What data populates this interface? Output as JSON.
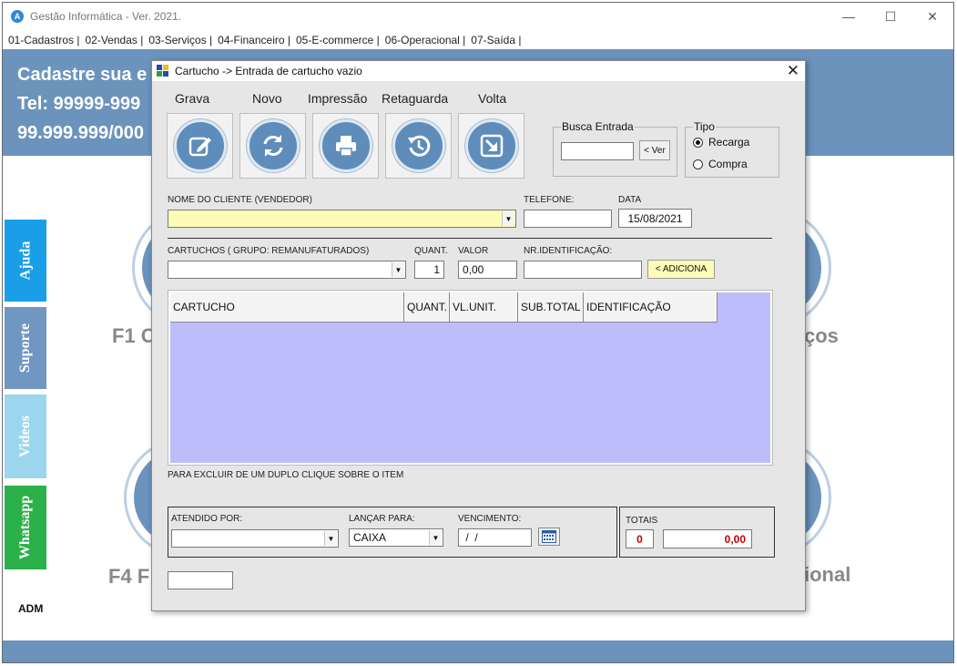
{
  "app": {
    "title": "Gestão Informática - Ver. 2021.",
    "logo_letter": "A",
    "controls": {
      "minimize": "—",
      "maximize": "☐",
      "close": "✕"
    }
  },
  "menu": [
    "01-Cadastros  |",
    "02-Vendas  |",
    "03-Serviços  |",
    "04-Financeiro  |",
    "05-E-commerce  |",
    "06-Operacional |",
    "07-Saída  |"
  ],
  "banner": {
    "line1": "Cadastre sua e",
    "line2": "Tel: 99999-999",
    "line3": "99.999.999/000"
  },
  "background": {
    "label_f1": "F1 C",
    "label_right1": "ços",
    "label_f4": "F4 F",
    "label_right2": "ional"
  },
  "side_tabs": [
    {
      "label": "Ajuda",
      "color": "#1a9ee8"
    },
    {
      "label": "Suporte",
      "color": "#7096c2"
    },
    {
      "label": "Videos",
      "color": "#9bd6ee"
    },
    {
      "label": "Whatsapp",
      "color": "#2bb04a"
    }
  ],
  "user": "ADM",
  "dialog": {
    "title": "Cartucho -> Entrada de cartucho vazio",
    "close": "✕",
    "toolbar": [
      {
        "label": "Grava",
        "icon": "edit-icon"
      },
      {
        "label": "Novo",
        "icon": "refresh-icon"
      },
      {
        "label": "Impressão",
        "icon": "printer-icon"
      },
      {
        "label": "Retaguarda",
        "icon": "history-icon"
      },
      {
        "label": "Volta",
        "icon": "arrow-down-right-icon"
      }
    ],
    "busca": {
      "title": "Busca Entrada",
      "value": "",
      "button": "< Ver"
    },
    "tipo": {
      "title": "Tipo",
      "options": [
        {
          "label": "Recarga",
          "selected": true
        },
        {
          "label": "Compra",
          "selected": false
        }
      ]
    },
    "cliente": {
      "label": "NOME DO CLIENTE (VENDEDOR)",
      "value": ""
    },
    "telefone": {
      "label": "TELEFONE:",
      "value": ""
    },
    "data": {
      "label": "DATA",
      "value": "15/08/2021"
    },
    "cartuchos": {
      "label": "CARTUCHOS ( GRUPO: REMANUFATURADOS)",
      "value": ""
    },
    "quant": {
      "label": "QUANT.",
      "value": "1"
    },
    "valor": {
      "label": "VALOR",
      "value": "0,00"
    },
    "nr_ident": {
      "label": "NR.IDENTIFICAÇÃO:",
      "value": ""
    },
    "adiciona_button": "< ADICIONA",
    "grid_columns": [
      "CARTUCHO",
      "QUANT.",
      "VL.UNIT.",
      "SUB.TOTAL",
      "IDENTIFICAÇÃO"
    ],
    "grid_rows": [],
    "hint": "PARA EXCLUIR DE UM DUPLO CLIQUE SOBRE O ITEM",
    "atendido": {
      "label": "ATENDIDO POR:",
      "value": ""
    },
    "lancar": {
      "label": "LANÇAR PARA:",
      "value": "CAIXA"
    },
    "vencimento": {
      "label": "VENCIMENTO:",
      "value": " /  /"
    },
    "totais": {
      "label": "TOTAIS",
      "count": "0",
      "amount": "0,00"
    },
    "bottom_field": ""
  },
  "colors": {
    "banner": "#6b93bc",
    "grid_bg": "#bdbdfb",
    "client_field_bg": "#fcfcb8",
    "adiciona_bg": "#fcfcb8",
    "totals_text": "#c00000"
  }
}
